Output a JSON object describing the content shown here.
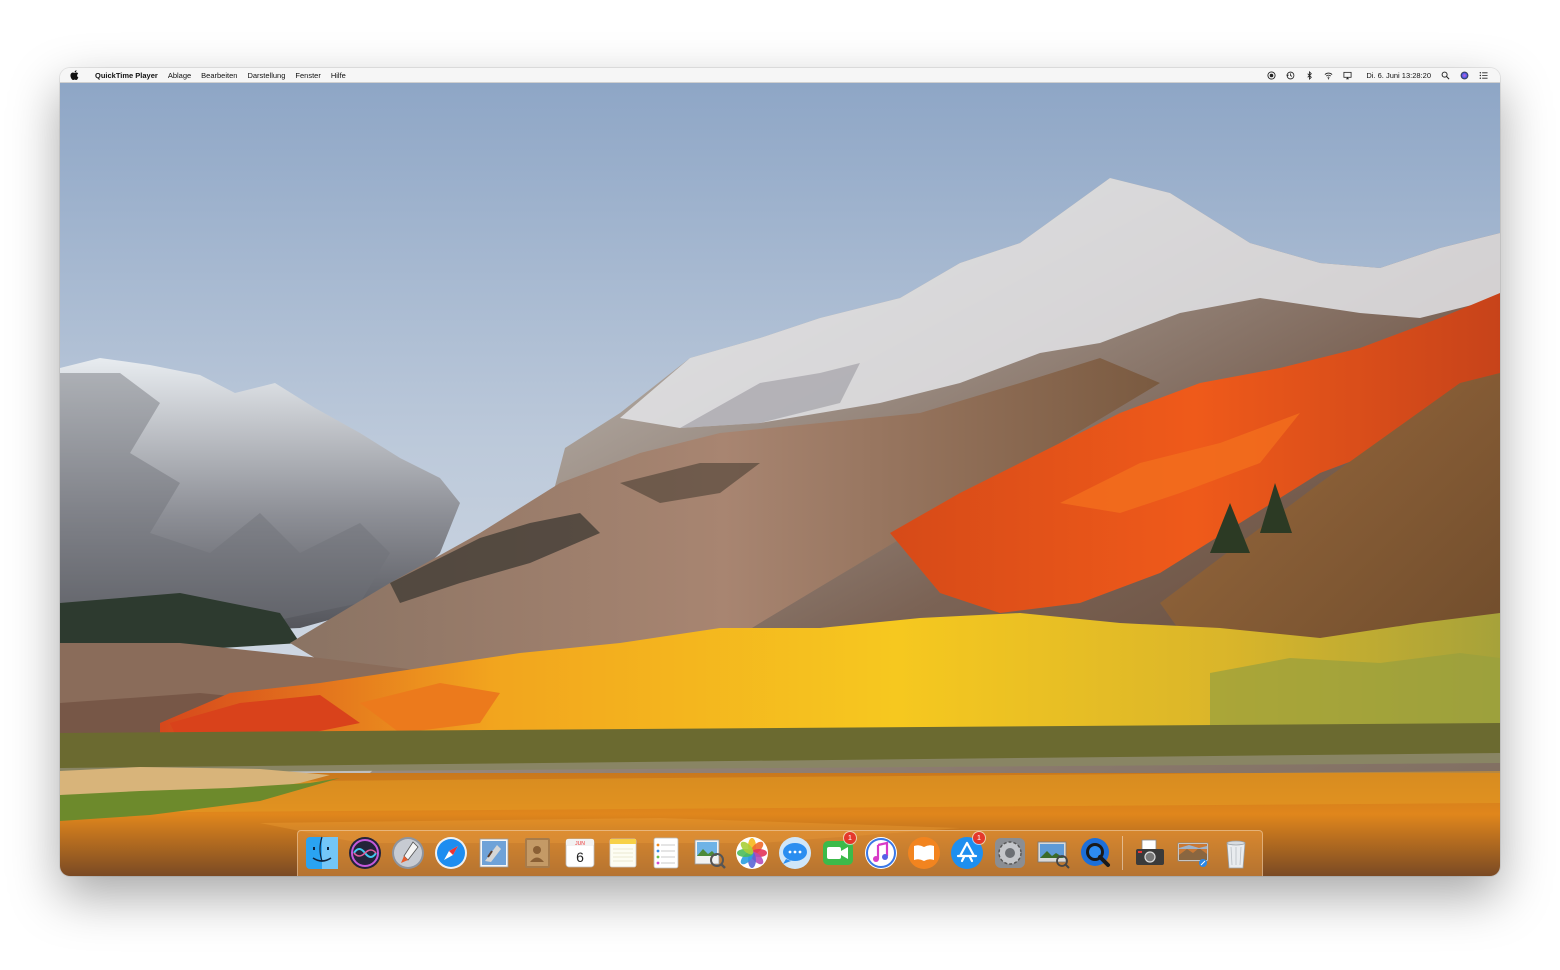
{
  "menubar": {
    "app_name": "QuickTime Player",
    "menus": [
      "Ablage",
      "Bearbeiten",
      "Darstellung",
      "Fenster",
      "Hilfe"
    ],
    "clock": "Di. 6. Juni  13:28:20",
    "status_icons": [
      "screen-record-icon",
      "time-machine-icon",
      "bluetooth-icon",
      "wifi-icon",
      "airplay-icon",
      "spotlight-icon",
      "siri-icon",
      "notification-center-icon"
    ]
  },
  "dock": {
    "items": [
      {
        "name": "Finder",
        "icon": "finder-icon"
      },
      {
        "name": "Siri",
        "icon": "siri-icon"
      },
      {
        "name": "Launchpad",
        "icon": "launchpad-icon"
      },
      {
        "name": "Safari",
        "icon": "safari-icon"
      },
      {
        "name": "Mail",
        "icon": "mail-icon"
      },
      {
        "name": "Contacts",
        "icon": "contacts-icon"
      },
      {
        "name": "Calendar",
        "icon": "calendar-icon",
        "day": "6",
        "month": "JUN"
      },
      {
        "name": "Notes",
        "icon": "notes-icon"
      },
      {
        "name": "Reminders",
        "icon": "reminders-icon"
      },
      {
        "name": "Preview",
        "icon": "preview-icon"
      },
      {
        "name": "Photos",
        "icon": "photos-icon"
      },
      {
        "name": "Messages",
        "icon": "messages-icon"
      },
      {
        "name": "FaceTime",
        "icon": "facetime-icon",
        "badge": "1"
      },
      {
        "name": "iTunes",
        "icon": "itunes-icon"
      },
      {
        "name": "iBooks",
        "icon": "ibooks-icon"
      },
      {
        "name": "App Store",
        "icon": "app-store-icon",
        "badge": "1"
      },
      {
        "name": "System Preferences",
        "icon": "system-preferences-icon"
      },
      {
        "name": "Image Capture",
        "icon": "image-capture-icon"
      },
      {
        "name": "QuickTime Player",
        "icon": "quicktime-icon"
      },
      {
        "name": "Screenshot",
        "icon": "screenshot-icon"
      },
      {
        "name": "Downloads",
        "icon": "downloads-stack-icon"
      },
      {
        "name": "Trash",
        "icon": "trash-icon"
      }
    ]
  },
  "colors": {
    "menubar_bg": "#f6f6f6",
    "dock_tint": "#e6963c",
    "badge": "#e5372b",
    "sky_top": "#8ea6c6",
    "sky_bottom": "#d6dee7"
  }
}
